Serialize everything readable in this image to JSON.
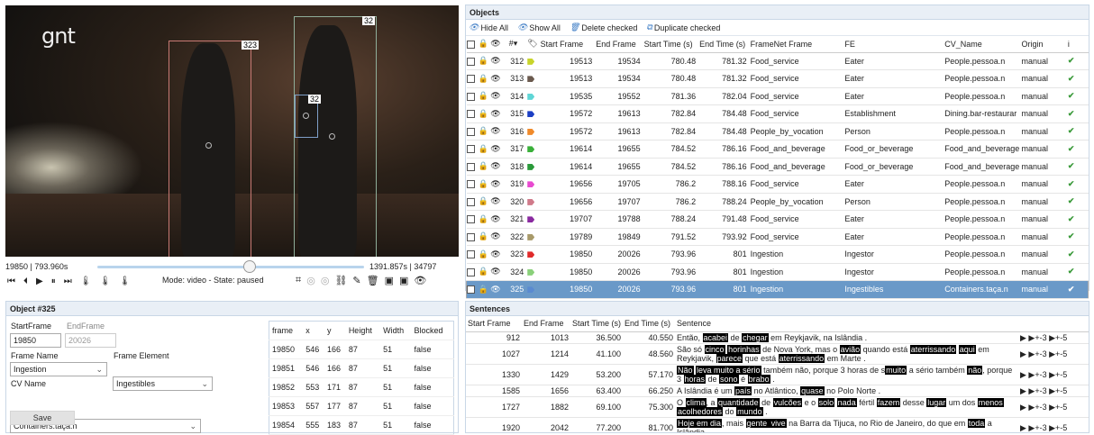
{
  "video": {
    "logo": "gnt",
    "labels": [
      "323",
      "32",
      "32"
    ],
    "time_left": "19850 | 793.960s",
    "time_right": "1391.857s | 34797",
    "position": 0.57,
    "mode_text": "Mode: video - State: paused"
  },
  "objects_panel": {
    "title": "Objects",
    "toolbar": {
      "hide_all": "Hide All",
      "show_all": "Show All",
      "delete_checked": "Delete checked",
      "duplicate_checked": "Duplicate checked"
    },
    "headers": [
      "#",
      "Start Frame",
      "End Frame",
      "Start Time (s)",
      "End Time (s)",
      "FrameNet Frame",
      "FE",
      "CV_Name",
      "Origin",
      "i"
    ],
    "rows": [
      {
        "id": "312",
        "color": "#c8d42a",
        "sf": "19513",
        "ef": "19534",
        "st": "780.48",
        "et": "781.32",
        "frame": "Food_service",
        "fe": "Eater",
        "cv": "People.pessoa.n",
        "origin": "manual"
      },
      {
        "id": "313",
        "color": "#6b5a4e",
        "sf": "19513",
        "ef": "19534",
        "st": "780.48",
        "et": "781.32",
        "frame": "Food_service",
        "fe": "Eater",
        "cv": "People.pessoa.n",
        "origin": "manual"
      },
      {
        "id": "314",
        "color": "#5fd6d6",
        "sf": "19535",
        "ef": "19552",
        "st": "781.36",
        "et": "782.04",
        "frame": "Food_service",
        "fe": "Eater",
        "cv": "People.pessoa.n",
        "origin": "manual"
      },
      {
        "id": "315",
        "color": "#1c3fc4",
        "sf": "19572",
        "ef": "19613",
        "st": "782.84",
        "et": "784.48",
        "frame": "Food_service",
        "fe": "Establishment",
        "cv": "Dining.bar-restaurar",
        "origin": "manual"
      },
      {
        "id": "316",
        "color": "#f08a2a",
        "sf": "19572",
        "ef": "19613",
        "st": "782.84",
        "et": "784.48",
        "frame": "People_by_vocation",
        "fe": "Person",
        "cv": "People.pessoa.n",
        "origin": "manual"
      },
      {
        "id": "317",
        "color": "#3ab03a",
        "sf": "19614",
        "ef": "19655",
        "st": "784.52",
        "et": "786.16",
        "frame": "Food_and_beverage",
        "fe": "Food_or_beverage",
        "cv": "Food_and_beverage",
        "origin": "manual"
      },
      {
        "id": "318",
        "color": "#2a9a3a",
        "sf": "19614",
        "ef": "19655",
        "st": "784.52",
        "et": "786.16",
        "frame": "Food_and_beverage",
        "fe": "Food_or_beverage",
        "cv": "Food_and_beverage",
        "origin": "manual"
      },
      {
        "id": "319",
        "color": "#e84ad0",
        "sf": "19656",
        "ef": "19705",
        "st": "786.2",
        "et": "788.16",
        "frame": "Food_service",
        "fe": "Eater",
        "cv": "People.pessoa.n",
        "origin": "manual"
      },
      {
        "id": "320",
        "color": "#d07a8a",
        "sf": "19656",
        "ef": "19707",
        "st": "786.2",
        "et": "788.24",
        "frame": "People_by_vocation",
        "fe": "Person",
        "cv": "People.pessoa.n",
        "origin": "manual"
      },
      {
        "id": "321",
        "color": "#8a2aa0",
        "sf": "19707",
        "ef": "19788",
        "st": "788.24",
        "et": "791.48",
        "frame": "Food_service",
        "fe": "Eater",
        "cv": "People.pessoa.n",
        "origin": "manual"
      },
      {
        "id": "322",
        "color": "#a89a6a",
        "sf": "19789",
        "ef": "19849",
        "st": "791.52",
        "et": "793.92",
        "frame": "Food_service",
        "fe": "Eater",
        "cv": "People.pessoa.n",
        "origin": "manual"
      },
      {
        "id": "323",
        "color": "#e02a2a",
        "sf": "19850",
        "ef": "20026",
        "st": "793.96",
        "et": "801",
        "frame": "Ingestion",
        "fe": "Ingestor",
        "cv": "People.pessoa.n",
        "origin": "manual"
      },
      {
        "id": "324",
        "color": "#8ad07a",
        "sf": "19850",
        "ef": "20026",
        "st": "793.96",
        "et": "801",
        "frame": "Ingestion",
        "fe": "Ingestor",
        "cv": "People.pessoa.n",
        "origin": "manual"
      },
      {
        "id": "325",
        "color": "#5a8ad0",
        "sf": "19850",
        "ef": "20026",
        "st": "793.96",
        "et": "801",
        "frame": "Ingestion",
        "fe": "Ingestibles",
        "cv": "Containers.taça.n",
        "origin": "manual"
      }
    ]
  },
  "object_detail": {
    "title": "Object #325",
    "start_frame_label": "StartFrame",
    "start_frame": "19850",
    "end_frame_label": "EndFrame",
    "end_frame": "20026",
    "frame_name_label": "Frame Name",
    "frame_name": "Ingestion",
    "frame_element_label": "Frame Element",
    "frame_element": "Ingestibles",
    "cv_name_label": "CV Name",
    "cv_name": "Containers.taça.n",
    "save": "Save",
    "frames_headers": [
      "frame",
      "x",
      "y",
      "Height",
      "Width",
      "Blocked"
    ],
    "frames": [
      [
        "19850",
        "546",
        "166",
        "87",
        "51",
        "false"
      ],
      [
        "19851",
        "546",
        "166",
        "87",
        "51",
        "false"
      ],
      [
        "19852",
        "553",
        "171",
        "87",
        "51",
        "false"
      ],
      [
        "19853",
        "557",
        "177",
        "87",
        "51",
        "false"
      ],
      [
        "19854",
        "555",
        "183",
        "87",
        "51",
        "false"
      ]
    ]
  },
  "sentences_panel": {
    "title": "Sentences",
    "headers": [
      "Start Frame",
      "End Frame",
      "Start Time (s)",
      "End Time (s)",
      "Sentence"
    ],
    "play_labels": [
      "+-3",
      "+-5"
    ],
    "rows": [
      {
        "sf": "912",
        "ef": "1013",
        "st": "36.500",
        "et": "40.550",
        "parts": [
          [
            "Então, ",
            0
          ],
          [
            "acabei",
            1
          ],
          [
            " de ",
            0
          ],
          [
            "chegar",
            1
          ],
          [
            " em Reykjavik, na Islândia .",
            0
          ]
        ]
      },
      {
        "sf": "1027",
        "ef": "1214",
        "st": "41.100",
        "et": "48.560",
        "parts": [
          [
            "São só ",
            0
          ],
          [
            "cinco",
            1
          ],
          [
            " ",
            0
          ],
          [
            "horinhas",
            1
          ],
          [
            " de Nova York, mas o ",
            0
          ],
          [
            "avião",
            1
          ],
          [
            " quando está ",
            0
          ],
          [
            "aterrissando",
            1
          ],
          [
            " ",
            0
          ],
          [
            "aqui",
            1
          ],
          [
            " em Reykjavik, ",
            0
          ],
          [
            "parece",
            1
          ],
          [
            " que está ",
            0
          ],
          [
            "aterrissando",
            1
          ],
          [
            " em Marte .",
            0
          ]
        ]
      },
      {
        "sf": "1330",
        "ef": "1429",
        "st": "53.200",
        "et": "57.170",
        "parts": [
          [
            "Não",
            1
          ],
          [
            " ",
            0
          ],
          [
            "leva muito a sério",
            1
          ],
          [
            " também não, porque 3 horas de s",
            0
          ],
          [
            "muito",
            1
          ],
          [
            " a sério também ",
            0
          ],
          [
            "não",
            1
          ],
          [
            ", porque 3 ",
            0
          ],
          [
            "horas",
            1
          ],
          [
            " de ",
            0
          ],
          [
            "sono",
            1
          ],
          [
            " é ",
            0
          ],
          [
            "brabo",
            1
          ],
          [
            " .",
            0
          ]
        ]
      },
      {
        "sf": "1585",
        "ef": "1656",
        "st": "63.400",
        "et": "66.250",
        "parts": [
          [
            "A Islândia é um ",
            0
          ],
          [
            "país",
            1
          ],
          [
            " no Atlântico, ",
            0
          ],
          [
            "quase",
            1
          ],
          [
            " no Polo Norte .",
            0
          ]
        ]
      },
      {
        "sf": "1727",
        "ef": "1882",
        "st": "69.100",
        "et": "75.300",
        "parts": [
          [
            "O ",
            0
          ],
          [
            "clima",
            1
          ],
          [
            ", a ",
            0
          ],
          [
            "quantidade",
            1
          ],
          [
            " de ",
            0
          ],
          [
            "vulcões",
            1
          ],
          [
            " e o ",
            0
          ],
          [
            "solo",
            1
          ],
          [
            " ",
            0
          ],
          [
            "nada",
            1
          ],
          [
            " fértil ",
            0
          ],
          [
            "fazem",
            1
          ],
          [
            " desse ",
            0
          ],
          [
            "lugar",
            1
          ],
          [
            " um dos ",
            0
          ],
          [
            "menos",
            1
          ],
          [
            " ",
            0
          ],
          [
            "acolhedores",
            1
          ],
          [
            " do ",
            0
          ],
          [
            "mundo",
            1
          ],
          [
            " .",
            0
          ]
        ]
      },
      {
        "sf": "1920",
        "ef": "2042",
        "st": "77.200",
        "et": "81.700",
        "parts": [
          [
            "Hoje em dia",
            1
          ],
          [
            ", mais ",
            0
          ],
          [
            "gente",
            1
          ],
          [
            " vive",
            1
          ],
          [
            " na Barra da Tijuca, no Rio de Janeiro, do que em ",
            0
          ],
          [
            "toda",
            1
          ],
          [
            " a Islândia .",
            0
          ]
        ]
      }
    ]
  }
}
